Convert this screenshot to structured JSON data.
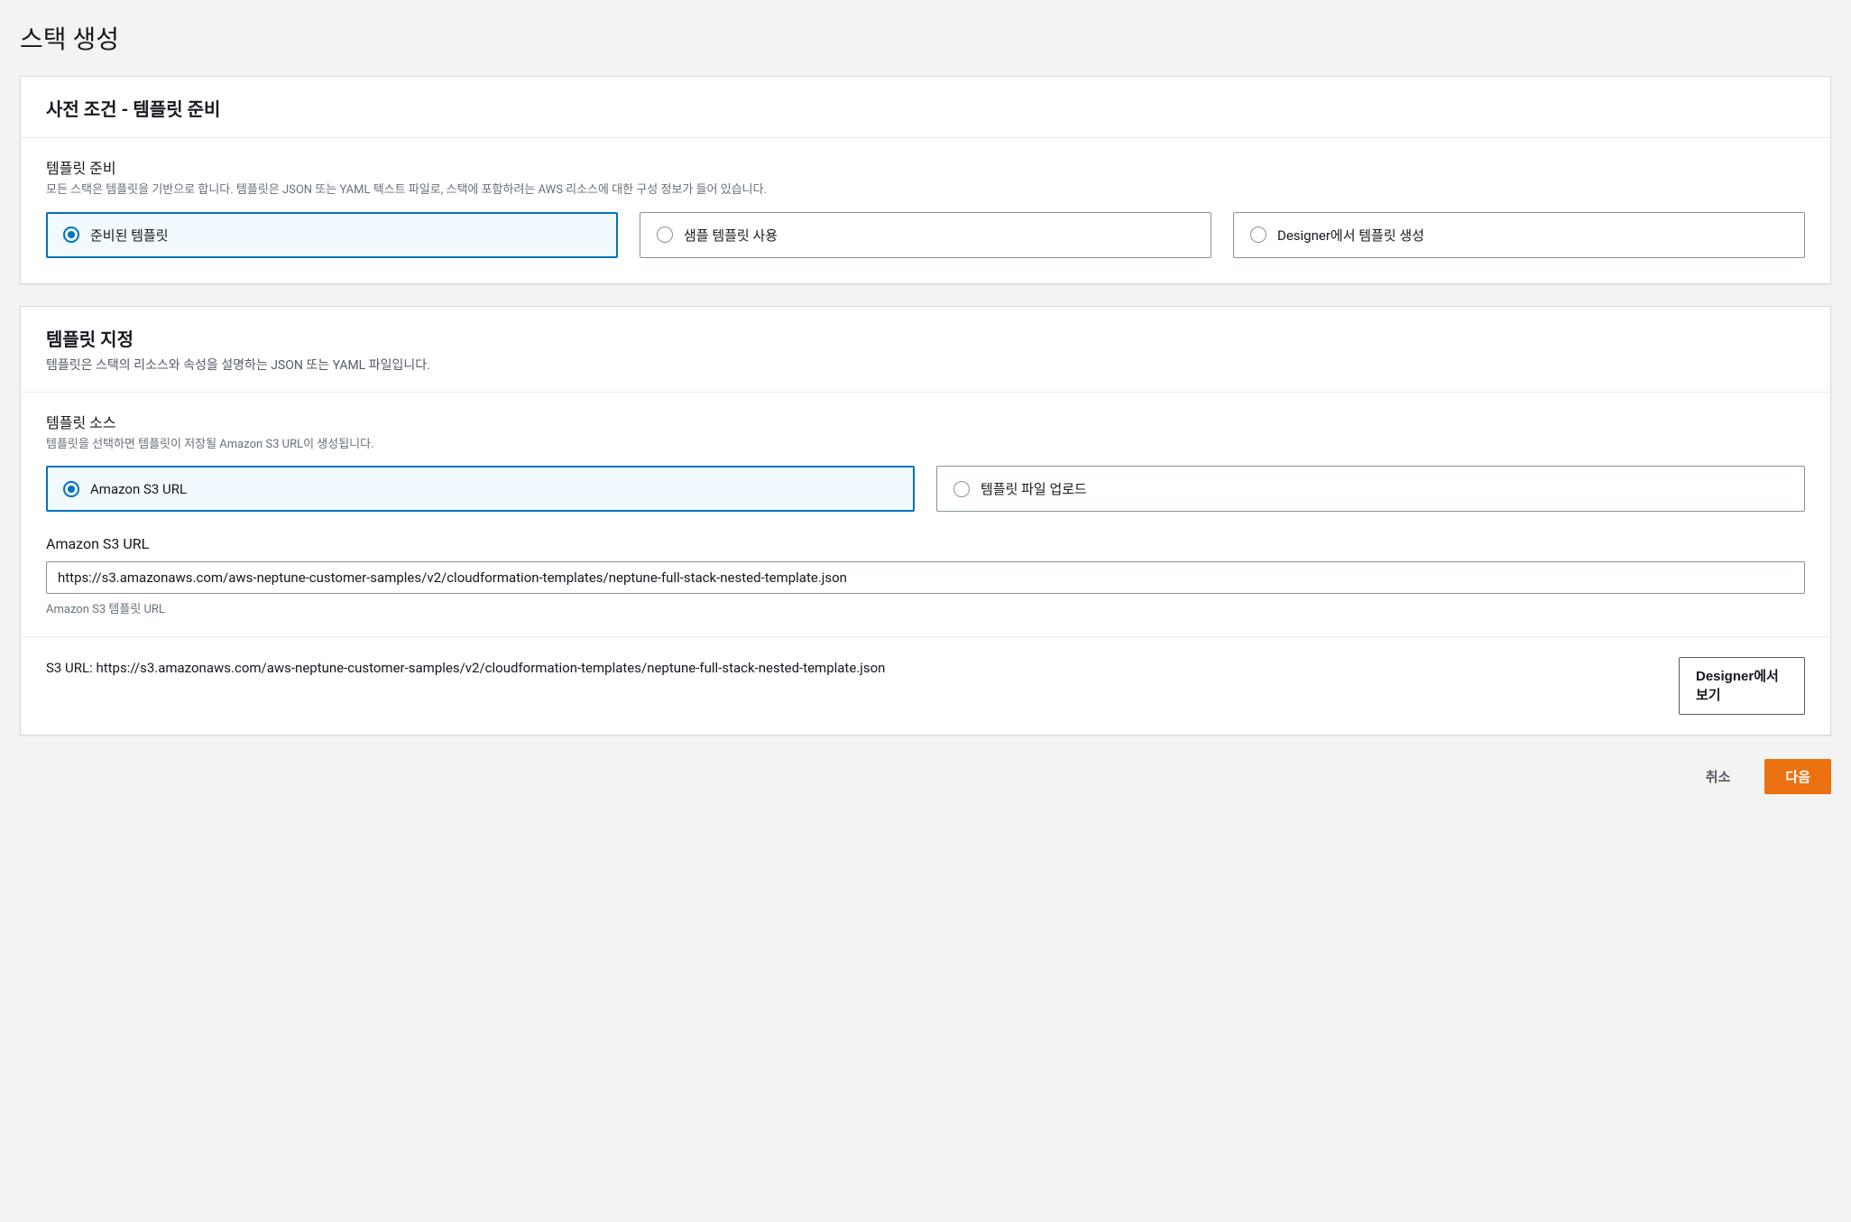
{
  "page": {
    "title": "스택 생성"
  },
  "prereq": {
    "heading": "사전 조건 - 템플릿 준비",
    "field_label": "템플릿 준비",
    "field_helper": "모든 스택은 템플릿을 기반으로 합니다. 템플릿은 JSON 또는 YAML 텍스트 파일로, 스택에 포함하려는 AWS 리소스에 대한 구성 정보가 들어 있습니다.",
    "options": [
      {
        "label": "준비된 템플릿",
        "selected": true
      },
      {
        "label": "샘플 템플릿 사용",
        "selected": false
      },
      {
        "label": "Designer에서 템플릿 생성",
        "selected": false
      }
    ]
  },
  "spec": {
    "heading": "템플릿 지정",
    "subtitle": "템플릿은 스택의 리소스와 속성을 설명하는 JSON 또는 YAML 파일입니다.",
    "source_label": "템플릿 소스",
    "source_helper": "템플릿을 선택하면 템플릿이 저장될 Amazon S3 URL이 생성됩니다.",
    "source_options": [
      {
        "label": "Amazon S3 URL",
        "selected": true
      },
      {
        "label": "템플릿 파일 업로드",
        "selected": false
      }
    ],
    "url_label": "Amazon S3 URL",
    "url_value": "https://s3.amazonaws.com/aws-neptune-customer-samples/v2/cloudformation-templates/neptune-full-stack-nested-template.json",
    "url_hint": "Amazon S3 템플릿 URL",
    "s3_display_label": "S3 URL:  ",
    "s3_display_value": "https://s3.amazonaws.com/aws-neptune-customer-samples/v2/cloudformation-templates/neptune-full-stack-nested-template.json",
    "designer_button": "Designer에서 보기"
  },
  "footer": {
    "cancel": "취소",
    "next": "다음"
  }
}
